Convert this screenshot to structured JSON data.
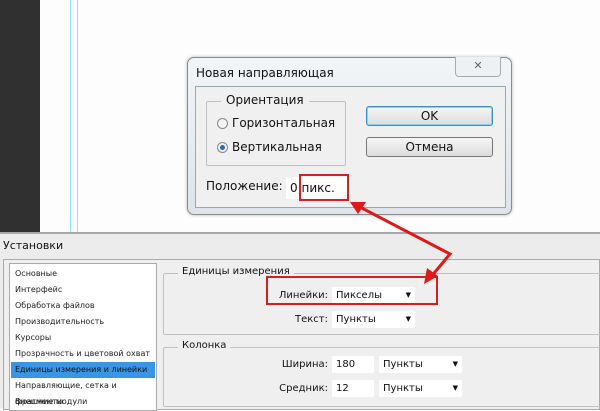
{
  "dialog": {
    "title": "Новая направляющая",
    "close_icon": "close-icon",
    "orientation_legend": "Ориентация",
    "radio_horizontal": "Горизонтальная",
    "radio_vertical": "Вертикальная",
    "selected": "Вертикальная",
    "ok_label": "OK",
    "cancel_label": "Отмена",
    "position_label": "Положение:",
    "position_value": "0",
    "position_unit": "пикс."
  },
  "prefs": {
    "title": "Установки",
    "sidebar": [
      "Основные",
      "Интерфейс",
      "Обработка файлов",
      "Производительность",
      "Курсоры",
      "Прозрачность и цветовой охват",
      "Единицы измерения и линейки",
      "Направляющие, сетка и фрагменты",
      "Внешние модули"
    ],
    "selected_index": 6,
    "units": {
      "legend": "Единицы измерения",
      "rulers_label": "Линейки:",
      "rulers_value": "Пикселы",
      "text_label": "Текст:",
      "text_value": "Пункты"
    },
    "column": {
      "legend": "Колонка",
      "width_label": "Ширина:",
      "width_value": "180",
      "width_unit": "Пункты",
      "gutter_label": "Средник:",
      "gutter_value": "12",
      "gutter_unit": "Пункты"
    }
  },
  "colors": {
    "highlight": "#d42020",
    "selection": "#3a95e4",
    "guide": "#8ee3ec"
  }
}
